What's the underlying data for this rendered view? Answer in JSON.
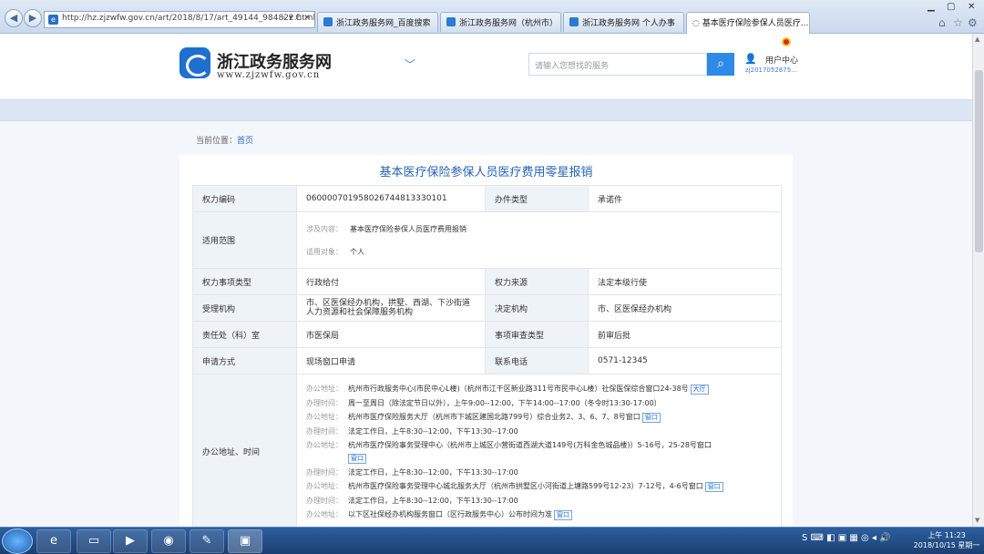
{
  "browser": {
    "url": "http://hz.zjzwfw.gov.cn/art/2018/8/17/art_49144_984822.html",
    "url_controls": "⌕ ▾ C ✕",
    "tabs": [
      {
        "label": "浙江政务服务网_百度搜索",
        "active": false
      },
      {
        "label": "浙江政务服务网（杭州市）",
        "active": false
      },
      {
        "label": "浙江政务服务网 个人办事",
        "active": false
      },
      {
        "label": "基本医疗保险参保人员医疗...",
        "active": true
      }
    ]
  },
  "header": {
    "site_name": "浙江政务服务网",
    "site_url": "www.zjzwfw.gov.cn",
    "search_placeholder": "请输入您想找的服务",
    "user_center": "用户中心",
    "user_id": "zj2017052875…"
  },
  "breadcrumb": {
    "prefix": "当前位置：",
    "home": "首页"
  },
  "page_title": "基本医疗保险参保人员医疗费用零星报销",
  "rows": {
    "code_label": "权力编码",
    "code_value": "060000701958026744813330101",
    "type_label": "办件类型",
    "type_value": "承诺件",
    "scope_label": "适用范围",
    "scope_content_key": "涉及内容：",
    "scope_content_value": "基本医疗保险参保人员医疗费用报销",
    "scope_target_key": "适用对象：",
    "scope_target_value": "个人",
    "category_label": "权力事项类型",
    "category_value": "行政给付",
    "source_label": "权力来源",
    "source_value": "法定本级行使",
    "agency_label": "受理机构",
    "agency_value": "市、区医保经办机构，拱墅、西湖、下沙街道人力资源和社会保障服务机构",
    "decision_label": "决定机构",
    "decision_value": "市、区医保经办机构",
    "dept_label": "责任处（科）室",
    "dept_value": "市医保局",
    "review_label": "事项审查类型",
    "review_value": "前审后批",
    "apply_label": "申请方式",
    "apply_value": "现场窗口申请",
    "phone_label": "联系电话",
    "phone_value": "0571-12345",
    "address_label": "办公地址、时间"
  },
  "offices": [
    {
      "addr_key": "办公地址：",
      "addr": "杭州市行政服务中心(市民中心L楼)（杭州市江干区新业路311号市民中心L楼）社保医保综合窗口24-38号",
      "btn": "大厅",
      "time_key": "办理时间：",
      "time": "周一至周日（除法定节日以外），上午9:00--12:00，下午14:00--17:00（冬令时13:30-17:00）"
    },
    {
      "addr_key": "办公地址：",
      "addr": "杭州市医疗保险服务大厅（杭州市下城区建国北路799号）综合业务2、3、6、7、8号窗口",
      "btn": "窗口",
      "time_key": "办理时间：",
      "time": "法定工作日，上午8:30--12:00，下午13:30--17:00"
    },
    {
      "addr_key": "办公地址：",
      "addr": "杭州市医疗保险事务受理中心（杭州市上城区小营街道西湖大道149号(万科金色城品楼)）5-16号，25-28号窗口",
      "btn": "窗口",
      "time_key": "办理时间：",
      "time": "法定工作日，上午8:30--12:00，下午13:30--17:00"
    },
    {
      "addr_key": "办公地址：",
      "addr": "杭州市医疗保险事务受理中心城北服务大厅（杭州市拱墅区小河街道上塘路599号12-23）7-12号，4-6号窗口",
      "btn": "窗口",
      "time_key": "办理时间：",
      "time": "法定工作日，上午8:30--12:00，下午13:30--17:00"
    },
    {
      "addr_key": "办公地址：",
      "addr": "以下区社保经办机构服务窗口（区行政服务中心）公布时间为准",
      "btn": "窗口",
      "time_key": "",
      "time": ""
    }
  ],
  "taskbar": {
    "time": "上午 11:23",
    "date": "2018/10/15 星期一",
    "tray": "S ⌨ ◧ ▣ ▦ ◎ ◂ 🔊"
  }
}
